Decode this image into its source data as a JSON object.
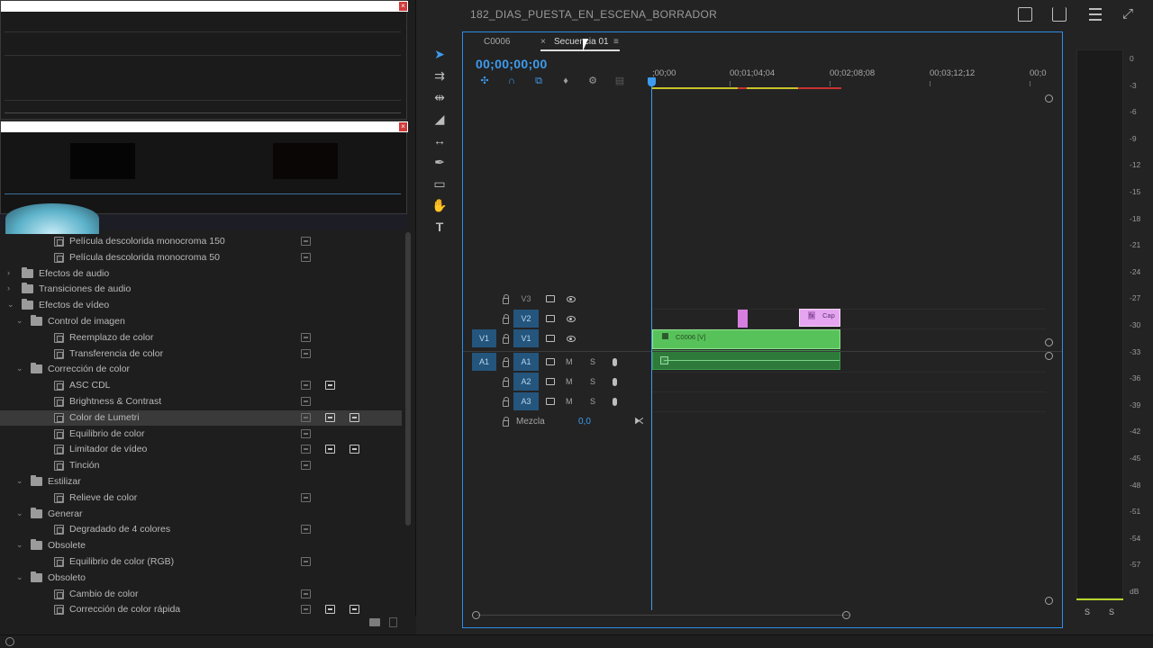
{
  "project_title": "182_DIAS_PUESTA_EN_ESCENA_BORRADOR",
  "effects_list": [
    {
      "type": "effect",
      "indent": 2,
      "label": "Película descolorida monocroma 150",
      "badges": [
        "off"
      ]
    },
    {
      "type": "effect",
      "indent": 2,
      "label": "Película descolorida monocroma 50",
      "badges": [
        "off"
      ]
    },
    {
      "type": "folder",
      "indent": 0,
      "label": "Efectos de audio",
      "expanded": false
    },
    {
      "type": "folder",
      "indent": 0,
      "label": "Transiciones de audio",
      "expanded": false
    },
    {
      "type": "folder",
      "indent": 0,
      "label": "Efectos de vídeo",
      "expanded": true
    },
    {
      "type": "folder",
      "indent": 1,
      "label": "Control de imagen",
      "expanded": true
    },
    {
      "type": "effect",
      "indent": 2,
      "label": "Reemplazo de color",
      "badges": [
        "off"
      ]
    },
    {
      "type": "effect",
      "indent": 2,
      "label": "Transferencia de color",
      "badges": [
        "off"
      ]
    },
    {
      "type": "folder",
      "indent": 1,
      "label": "Corrección de color",
      "expanded": true
    },
    {
      "type": "effect",
      "indent": 2,
      "label": "ASC CDL",
      "badges": [
        "off",
        "on"
      ]
    },
    {
      "type": "effect",
      "indent": 2,
      "label": "Brightness & Contrast",
      "badges": [
        "off"
      ]
    },
    {
      "type": "effect",
      "indent": 2,
      "label": "Color de Lumetri",
      "badges": [
        "off",
        "on",
        "on"
      ],
      "selected": true
    },
    {
      "type": "effect",
      "indent": 2,
      "label": "Equilibrio de color",
      "badges": [
        "off"
      ]
    },
    {
      "type": "effect",
      "indent": 2,
      "label": "Limitador de vídeo",
      "badges": [
        "off",
        "on",
        "on"
      ]
    },
    {
      "type": "effect",
      "indent": 2,
      "label": "Tinción",
      "badges": [
        "off"
      ]
    },
    {
      "type": "folder",
      "indent": 1,
      "label": "Estilizar",
      "expanded": true
    },
    {
      "type": "effect",
      "indent": 2,
      "label": "Relieve de color",
      "badges": [
        "off"
      ]
    },
    {
      "type": "folder",
      "indent": 1,
      "label": "Generar",
      "expanded": true
    },
    {
      "type": "effect",
      "indent": 2,
      "label": "Degradado de 4 colores",
      "badges": [
        "off"
      ]
    },
    {
      "type": "folder",
      "indent": 1,
      "label": "Obsolete",
      "expanded": true
    },
    {
      "type": "effect",
      "indent": 2,
      "label": "Equilibrio de color (RGB)",
      "badges": [
        "off"
      ]
    },
    {
      "type": "folder",
      "indent": 1,
      "label": "Obsoleto",
      "expanded": true
    },
    {
      "type": "effect",
      "indent": 2,
      "label": "Cambio de color",
      "badges": [
        "off"
      ]
    },
    {
      "type": "effect",
      "indent": 2,
      "label": "Corrección de color rápida",
      "badges": [
        "off",
        "on",
        "on"
      ]
    }
  ],
  "timeline": {
    "tabs": {
      "first": "C0006",
      "close": "×",
      "active": "Secuencia 01",
      "menu": "≡"
    },
    "timecode": "00;00;00;00",
    "ruler_ticks": [
      ";00;00",
      "00;01;04;04",
      "00;02;08;08",
      "00;03;12;12",
      "00;0"
    ],
    "tracks": {
      "v3": "V3",
      "v2": "V2",
      "v1": "V1",
      "v1_source": "V1",
      "a1": "A1",
      "a2": "A2",
      "a3": "A3",
      "a1_source": "A1",
      "m": "M",
      "s": "S"
    },
    "clips": {
      "video": "C0006 [V]",
      "caption": "Cap",
      "caption_fx": "fx"
    },
    "mix_label": "Mezcla",
    "mix_value": "0,0"
  },
  "meter": {
    "db_labels": [
      "0",
      "-3",
      "-6",
      "-9",
      "-12",
      "-15",
      "-18",
      "-21",
      "-24",
      "-27",
      "-30",
      "-33",
      "-36",
      "-39",
      "-42",
      "-45",
      "-48",
      "-51",
      "-54",
      "-57",
      "dB"
    ],
    "solo_left": "S",
    "solo_right": "S",
    "level_color": "#b6d42b"
  },
  "colors": {
    "accent": "#3d9cf0",
    "video_clip": "#58c25a",
    "audio_clip": "#2e7a3a",
    "caption_clip": "#e6a5f0",
    "selected_track": "#24557d"
  }
}
